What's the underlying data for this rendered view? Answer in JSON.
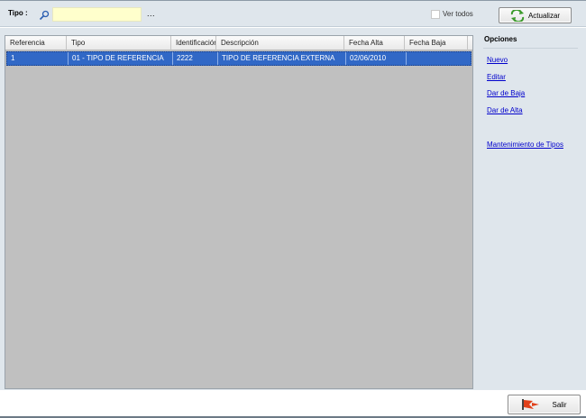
{
  "filter": {
    "label": "Tipo :",
    "value": "",
    "ellipsis": "...",
    "ver_todos_label": "Ver todos",
    "ver_todos_checked": false,
    "actualizar_label": "Actualizar"
  },
  "grid": {
    "columns": [
      "Referencia",
      "Tipo",
      "Identificación",
      "Descripción",
      "Fecha Alta",
      "Fecha Baja"
    ],
    "rows": [
      [
        "1",
        "01 - TIPO DE REFERENCIA",
        "2222",
        "TIPO DE REFERENCIA EXTERNA",
        "02/06/2010",
        ""
      ]
    ],
    "selected_row": 0
  },
  "opciones": {
    "title": "Opciones",
    "links": [
      "Nuevo",
      "Editar",
      "Dar de Baja",
      "Dar de Alta",
      "Mantenimiento de Tipos"
    ]
  },
  "footer": {
    "salir_label": "Salir"
  },
  "colors": {
    "selection": "#3168c6",
    "panel_bg": "#dfe6ec",
    "input_bg": "#ffffcc",
    "grid_bg": "#c0c0c0",
    "link": "#0000cc"
  },
  "icons": [
    "search-icon",
    "refresh-icon",
    "exit-icon"
  ]
}
